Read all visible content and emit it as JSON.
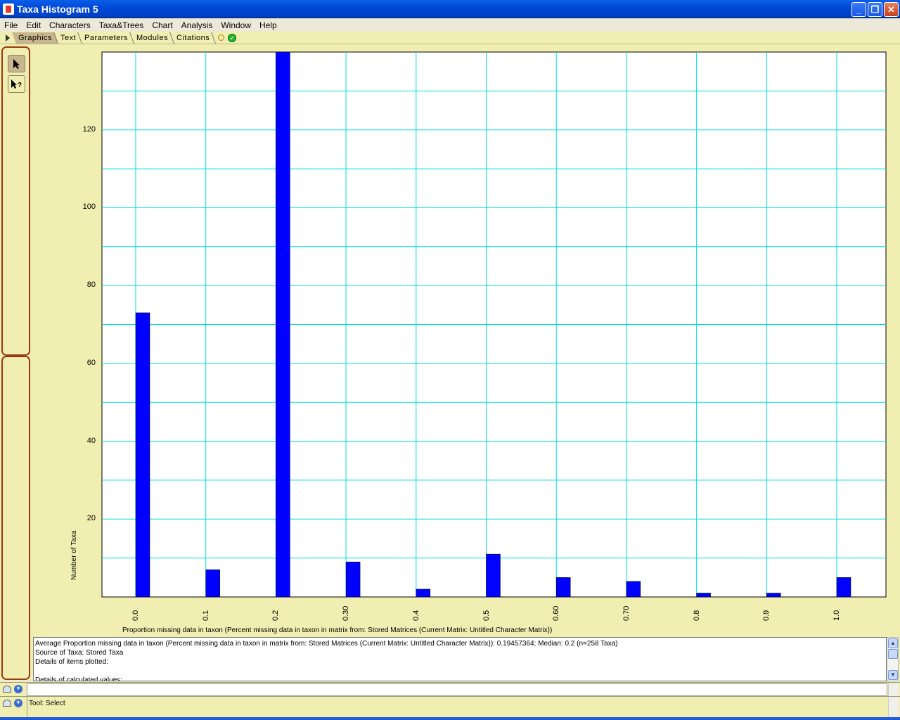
{
  "window": {
    "title": "Taxa Histogram 5",
    "buttons": [
      "_",
      "❐",
      "✕"
    ]
  },
  "menu": [
    "File",
    "Edit",
    "Characters",
    "Taxa&Trees",
    "Chart",
    "Analysis",
    "Window",
    "Help"
  ],
  "tabs": [
    "Graphics",
    "Text",
    "Parameters",
    "Modules",
    "Citations"
  ],
  "tools": {
    "select_icon": "arrow-pointer-icon",
    "help_icon": "arrow-question-icon"
  },
  "chart_data": {
    "type": "bar",
    "x": [
      "0.0",
      "0.1",
      "0.2",
      "0.30",
      "0.4",
      "0.5",
      "0.60",
      "0.70",
      "0.8",
      "0.9",
      "1.0"
    ],
    "values": [
      73,
      7,
      140,
      9,
      2,
      11,
      5,
      4,
      1,
      1,
      5
    ],
    "ylabel": "Number of Taxa",
    "xlabel": "Proportion missing data in taxon (Percent missing data in taxon in matrix from: Stored Matrices (Current Matrix: Untitled Character Matrix))",
    "yticks": [
      20,
      40,
      60,
      80,
      100,
      120
    ],
    "ylim": [
      0,
      140
    ],
    "grid": true,
    "bar_color": "#0000ff",
    "grid_color": "#00dede"
  },
  "output_text": [
    "Average Proportion missing data in taxon (Percent missing data in taxon in matrix from: Stored Matrices (Current Matrix: Untitled Character Matrix)): 0.19457364; Median: 0.2  (n=258  Taxa)",
    "Source of  Taxa: Stored Taxa",
    "Details of items plotted:",
    "",
    "Details of  calculated values:"
  ],
  "status": {
    "tool_label": "Tool: Select"
  }
}
